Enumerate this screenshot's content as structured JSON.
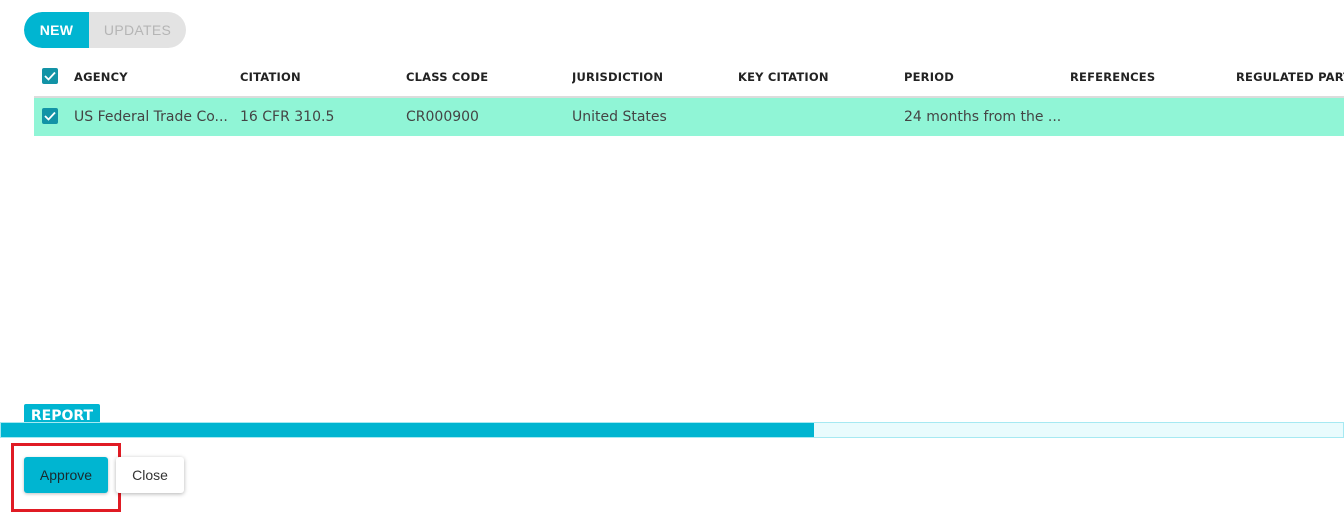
{
  "toggle": {
    "new_label": "NEW",
    "updates_label": "UPDATES",
    "active": "NEW"
  },
  "table": {
    "columns": [
      "AGENCY",
      "CITATION",
      "CLASS CODE",
      "JURISDICTION",
      "KEY CITATION",
      "PERIOD",
      "REFERENCES",
      "REGULATED PARTY"
    ],
    "rows": [
      {
        "selected": true,
        "cells": [
          "US Federal Trade Co...",
          "16 CFR 310.5",
          "CR000900",
          "United States",
          "",
          "24 months from the ...",
          "",
          ""
        ]
      }
    ]
  },
  "report": {
    "tab_label": "REPORT",
    "progress_fraction": 0.606
  },
  "actions": {
    "approve_label": "Approve",
    "close_label": "Close"
  },
  "colors": {
    "accent": "#00b5d1",
    "row_selected": "#90f5d6",
    "highlight": "#e01b24"
  }
}
